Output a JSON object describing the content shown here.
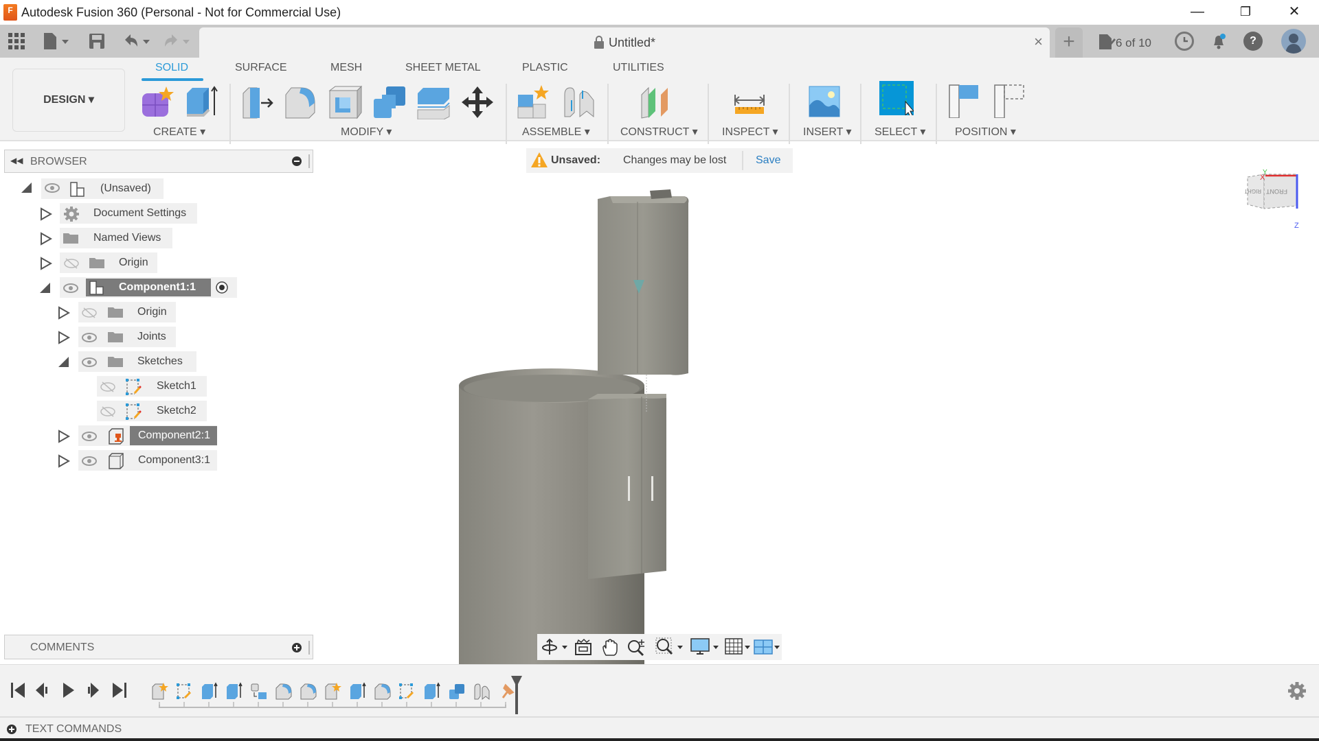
{
  "window": {
    "title": "Autodesk Fusion 360 (Personal - Not for Commercial Use)",
    "app_icon_letter": "F",
    "minimize": "—",
    "restore": "❐",
    "close": "✕"
  },
  "quick_access": {
    "document_tab_title": "Untitled*",
    "document_tab_close": "×",
    "new_tab": "+",
    "job_status": "6 of 10"
  },
  "ribbon": {
    "workspace": "DESIGN ▾",
    "tabs": [
      {
        "label": "SOLID",
        "active": true
      },
      {
        "label": "SURFACE",
        "active": false
      },
      {
        "label": "MESH",
        "active": false
      },
      {
        "label": "SHEET METAL",
        "active": false
      },
      {
        "label": "PLASTIC",
        "active": false
      },
      {
        "label": "UTILITIES",
        "active": false
      }
    ],
    "groups": [
      {
        "label": "CREATE ▾"
      },
      {
        "label": "MODIFY ▾"
      },
      {
        "label": "ASSEMBLE ▾"
      },
      {
        "label": "CONSTRUCT ▾"
      },
      {
        "label": "INSPECT ▾"
      },
      {
        "label": "INSERT ▾"
      },
      {
        "label": "SELECT ▾"
      },
      {
        "label": "POSITION ▾"
      }
    ]
  },
  "browser": {
    "title": "BROWSER",
    "items": [
      {
        "label": "(Unsaved)",
        "expanded": true,
        "visible": true
      },
      {
        "label": "Document Settings",
        "expanded": false
      },
      {
        "label": "Named Views",
        "expanded": false
      },
      {
        "label": "Origin",
        "expanded": false,
        "visible": false
      },
      {
        "label": "Component1:1",
        "expanded": true,
        "visible": true,
        "active": true
      },
      {
        "label": "Origin",
        "expanded": false,
        "visible": false
      },
      {
        "label": "Joints",
        "expanded": false,
        "visible": true
      },
      {
        "label": "Sketches",
        "expanded": true,
        "visible": true
      },
      {
        "label": "Sketch1",
        "visible": false
      },
      {
        "label": "Sketch2",
        "visible": false
      },
      {
        "label": "Component2:1",
        "expanded": false,
        "visible": true,
        "selected": true
      },
      {
        "label": "Component3:1",
        "expanded": false,
        "visible": true
      }
    ]
  },
  "notice": {
    "label": "Unsaved:",
    "message": "Changes may be lost",
    "action": "Save"
  },
  "viewcube": {
    "faces": [
      "FRONT",
      "RIGHT"
    ],
    "axes": [
      "X",
      "Y",
      "Z"
    ]
  },
  "comments": {
    "title": "COMMENTS"
  },
  "timeline": {
    "feature_count": 15
  },
  "text_commands": {
    "title": "TEXT COMMANDS"
  },
  "colors": {
    "accent": "#2b9ad8",
    "warning": "#f5a623",
    "selected_bg": "#7b7b7b",
    "select_button": "#0696d7"
  }
}
